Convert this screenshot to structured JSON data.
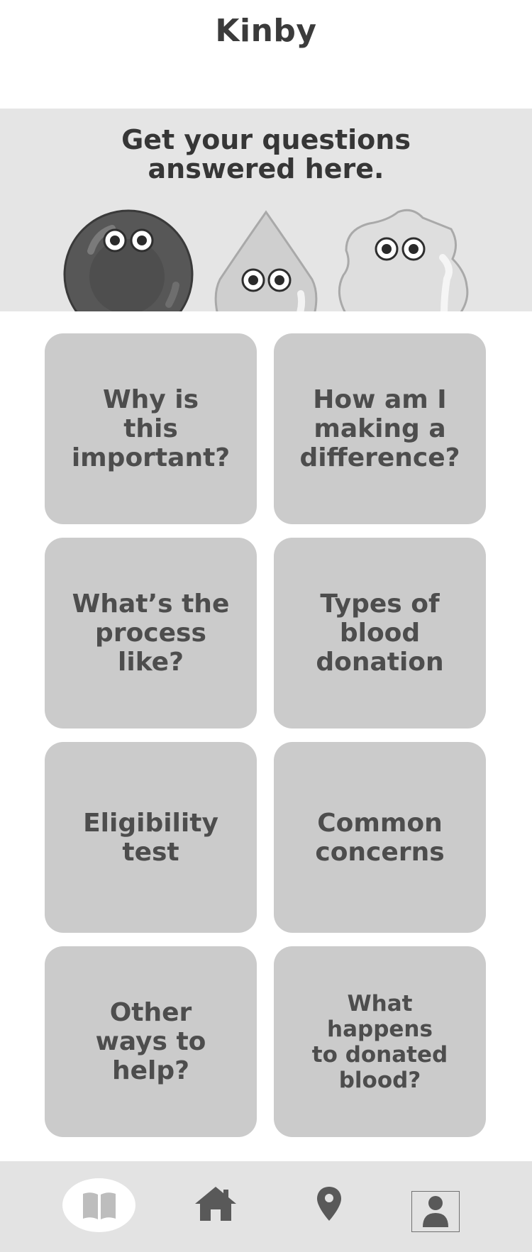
{
  "header": {
    "title": "Kinby"
  },
  "hero": {
    "title_line1": "Get your questions",
    "title_line2": "answered here."
  },
  "cards": [
    {
      "label": "Why is\nthis\nimportant?"
    },
    {
      "label": "How am I\nmaking a\ndifference?"
    },
    {
      "label": "What’s the\nprocess\nlike?"
    },
    {
      "label": "Types of\nblood\ndonation"
    },
    {
      "label": "Eligibility\ntest"
    },
    {
      "label": "Common\nconcerns"
    },
    {
      "label": "Other\nways to\nhelp?"
    },
    {
      "label": "What happens\nto donated\nblood?"
    }
  ],
  "nav": {
    "items": [
      {
        "icon": "book-icon",
        "active": true
      },
      {
        "icon": "home-icon",
        "active": false
      },
      {
        "icon": "location-pin-icon",
        "active": false
      },
      {
        "icon": "profile-icon",
        "active": false
      }
    ]
  },
  "colors": {
    "card_bg": "#cbcbcb",
    "hero_bg": "#e5e5e5",
    "nav_bg": "#e3e3e3",
    "text_dark": "#3b3b3b",
    "card_text": "#4d4d4d",
    "icon_gray": "#5a5a5a"
  }
}
